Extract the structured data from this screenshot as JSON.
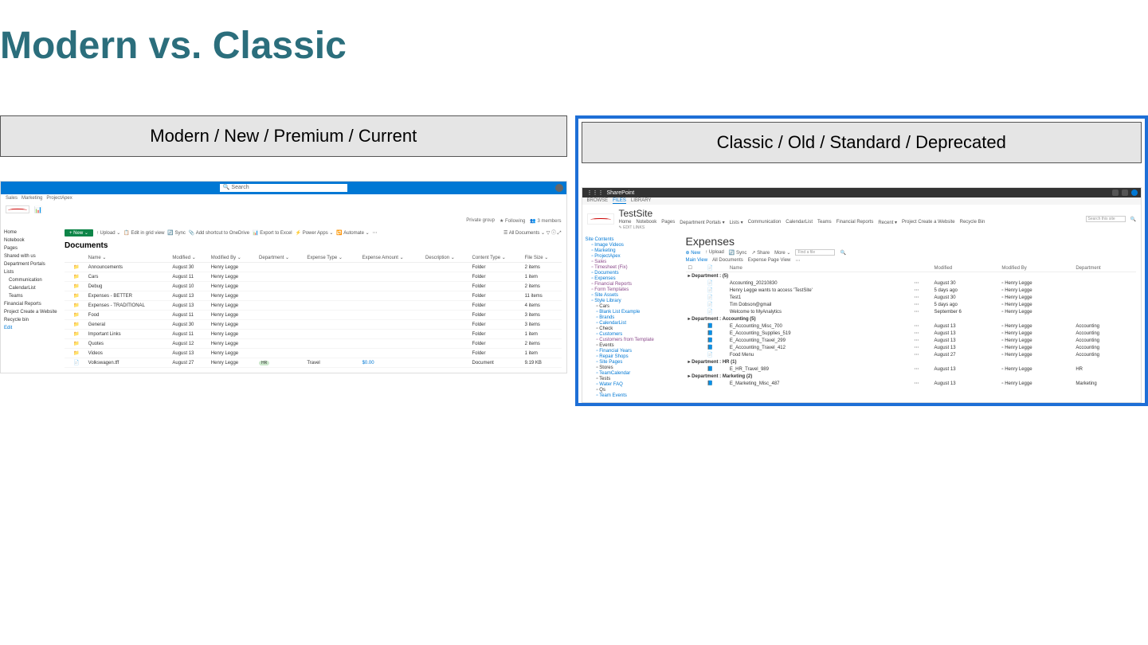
{
  "slide": {
    "title": "Modern vs. Classic"
  },
  "panels": {
    "left_label": "Modern / New / Premium / Current",
    "right_label": "Classic / Old / Standard / Deprecated"
  },
  "modern": {
    "search_placeholder": "🔍 Search",
    "nav_links": [
      "Sales",
      "Marketing",
      "ProjectApex"
    ],
    "status": {
      "group": "Private group",
      "following": "★ Following",
      "members": "👥 3 members"
    },
    "sidebar": {
      "items": [
        "Home",
        "Notebook",
        "Pages",
        "Shared with us",
        "Department Portals",
        "Lists",
        "Communication",
        "CalendarList",
        "Teams",
        "Financial Reports",
        "Project Create a Website",
        "Recycle bin",
        "Edit"
      ]
    },
    "toolbar": {
      "new": "+ New ⌄",
      "items": [
        "↑ Upload ⌄",
        "📋 Edit in grid view",
        "🔄 Sync",
        "📎 Add shortcut to OneDrive",
        "📊 Export to Excel",
        "⚡ Power Apps ⌄",
        "🔁 Automate ⌄",
        "⋯"
      ],
      "right": "☰ All Documents ⌄  ▽  ⓘ  ⤢"
    },
    "library_title": "Documents",
    "columns": [
      "",
      "",
      "Name ⌄",
      "Modified ⌄",
      "Modified By ⌄",
      "Department ⌄",
      "Expense Type ⌄",
      "Expense Amount ⌄",
      "Description ⌄",
      "Content Type ⌄",
      "File Size ⌄"
    ],
    "rows": [
      {
        "icon": "folder",
        "name": "Announcements",
        "mod": "August 30",
        "by": "Henry Legge",
        "ct": "Folder",
        "size": "2 items"
      },
      {
        "icon": "folder",
        "name": "Cars",
        "mod": "August 11",
        "by": "Henry Legge",
        "ct": "Folder",
        "size": "1 item"
      },
      {
        "icon": "folder",
        "name": "Debug",
        "mod": "August 10",
        "by": "Henry Legge",
        "ct": "Folder",
        "size": "2 items"
      },
      {
        "icon": "folder",
        "name": "Expenses - BETTER",
        "mod": "August 13",
        "by": "Henry Legge",
        "ct": "Folder",
        "size": "11 items"
      },
      {
        "icon": "folder",
        "name": "Expenses - TRADITIONAL",
        "mod": "August 13",
        "by": "Henry Legge",
        "ct": "Folder",
        "size": "4 items"
      },
      {
        "icon": "folder",
        "name": "Food",
        "mod": "August 11",
        "by": "Henry Legge",
        "ct": "Folder",
        "size": "3 items"
      },
      {
        "icon": "folder",
        "name": "General",
        "mod": "August 30",
        "by": "Henry Legge",
        "ct": "Folder",
        "size": "3 items"
      },
      {
        "icon": "folder",
        "name": "Important Links",
        "mod": "August 11",
        "by": "Henry Legge",
        "ct": "Folder",
        "size": "1 item"
      },
      {
        "icon": "folder",
        "name": "Quotes",
        "mod": "August 12",
        "by": "Henry Legge",
        "ct": "Folder",
        "size": "2 items"
      },
      {
        "icon": "folder",
        "name": "Videos",
        "mod": "August 13",
        "by": "Henry Legge",
        "ct": "Folder",
        "size": "1 item"
      },
      {
        "icon": "file",
        "name": "Volkswagen.tff",
        "mod": "August 27",
        "by": "Henry Legge",
        "dept": "HR",
        "etype": "Travel",
        "amt": "$0.00",
        "ct": "Document",
        "size": "9.19 KB"
      }
    ]
  },
  "classic": {
    "brand": "SharePoint",
    "ribbon": [
      "BROWSE",
      "FILES",
      "LIBRARY"
    ],
    "site_title": "TestSite",
    "nav_row": [
      "Home",
      "Notebook",
      "Pages",
      "Department Portals ▾",
      "Lists ▾",
      "Communication",
      "CalendarList",
      "Teams",
      "Financial Reports",
      "Recent ▾",
      "Project Create a Website",
      "Recycle Bin"
    ],
    "edit_links": "✎ EDIT LINKS",
    "search_placeholder": "Search this site",
    "tree": {
      "title": "Site Contents",
      "items": [
        {
          "label": "Image Videos",
          "cls": "tree-blue tree-sub"
        },
        {
          "label": "Marketing",
          "cls": "tree-blue tree-sub"
        },
        {
          "label": "ProjectApex",
          "cls": "tree-blue tree-sub"
        },
        {
          "label": "Sales",
          "cls": "tree-purple tree-sub"
        },
        {
          "label": "Timesheet (Fix)",
          "cls": "tree-purple tree-sub"
        },
        {
          "label": "Documents",
          "cls": "tree-blue tree-sub"
        },
        {
          "label": "Expenses",
          "cls": "tree-blue tree-sub"
        },
        {
          "label": "Financial Reports",
          "cls": "tree-purple tree-sub"
        },
        {
          "label": "Form Templates",
          "cls": "tree-purple tree-sub"
        },
        {
          "label": "Site Assets",
          "cls": "tree-blue tree-sub"
        },
        {
          "label": "Style Library",
          "cls": "tree-blue tree-sub"
        },
        {
          "label": "Cars",
          "cls": "tree-sub2"
        },
        {
          "label": "Blank List Example",
          "cls": "tree-blue tree-sub2"
        },
        {
          "label": "Brands",
          "cls": "tree-blue tree-sub2"
        },
        {
          "label": "CalendarList",
          "cls": "tree-blue tree-sub2"
        },
        {
          "label": "Check",
          "cls": "tree-sub2"
        },
        {
          "label": "Customers",
          "cls": "tree-blue tree-sub2"
        },
        {
          "label": "Customers from Template",
          "cls": "tree-purple tree-sub2"
        },
        {
          "label": "Events",
          "cls": "tree-sub2"
        },
        {
          "label": "Financial Years",
          "cls": "tree-blue tree-sub2"
        },
        {
          "label": "Repair Shops",
          "cls": "tree-blue tree-sub2"
        },
        {
          "label": "Site Pages",
          "cls": "tree-blue tree-sub2"
        },
        {
          "label": "Stores",
          "cls": "tree-sub2"
        },
        {
          "label": "TeamCalendar",
          "cls": "tree-blue tree-sub2"
        },
        {
          "label": "Tests",
          "cls": "tree-sub2"
        },
        {
          "label": "Water FAQ",
          "cls": "tree-blue tree-sub2"
        },
        {
          "label": "Qs",
          "cls": "tree-sub2"
        },
        {
          "label": "Team Events",
          "cls": "tree-blue tree-sub2"
        }
      ]
    },
    "library_title": "Expenses",
    "toolbar": {
      "new": "⊕ New",
      "upload": "↑ Upload",
      "sync": "🔄 Sync",
      "share": "↗ Share",
      "more": "More ⌄",
      "find": "Find a file"
    },
    "views": [
      "Main View",
      "All Documents",
      "Expense Page View",
      "⋯"
    ],
    "columns": [
      "☐",
      "📄",
      "Name",
      "",
      "Modified",
      "Modified By",
      "Department"
    ],
    "groups": [
      {
        "label": "▸ Department : (5)",
        "rows": [
          {
            "icon": "📄",
            "name": "Accounting_20210830",
            "mod": "August 30",
            "by": "Henry Legge"
          },
          {
            "icon": "📄",
            "name": "Henry Legge wants to access 'TestSite'",
            "mod": "5 days ago",
            "by": "Henry Legge"
          },
          {
            "icon": "📄",
            "name": "Test1",
            "mod": "August 30",
            "by": "Henry Legge"
          },
          {
            "icon": "📄",
            "name": "Tim Dobson@gmail",
            "mod": "5 days ago",
            "by": "Henry Legge"
          },
          {
            "icon": "📄",
            "name": "Welcome to MyAnalytics",
            "mod": "September 6",
            "by": "Henry Legge"
          }
        ]
      },
      {
        "label": "▸ Department : Accounting (5)",
        "rows": [
          {
            "icon": "📘",
            "name": "E_Accounting_Misc_700",
            "mod": "August 13",
            "by": "Henry Legge",
            "dept": "Accounting"
          },
          {
            "icon": "📘",
            "name": "E_Accounting_Supplies_519",
            "mod": "August 13",
            "by": "Henry Legge",
            "dept": "Accounting"
          },
          {
            "icon": "📘",
            "name": "E_Accounting_Travel_299",
            "mod": "August 13",
            "by": "Henry Legge",
            "dept": "Accounting"
          },
          {
            "icon": "📘",
            "name": "E_Accounting_Travel_412",
            "mod": "August 13",
            "by": "Henry Legge",
            "dept": "Accounting"
          },
          {
            "icon": "📄",
            "name": "Food Menu",
            "mod": "August 27",
            "by": "Henry Legge",
            "dept": "Accounting"
          }
        ]
      },
      {
        "label": "▸ Department : HR (1)",
        "rows": [
          {
            "icon": "📘",
            "name": "E_HR_Travel_989",
            "mod": "August 13",
            "by": "Henry Legge",
            "dept": "HR"
          }
        ]
      },
      {
        "label": "▸ Department : Marketing (2)",
        "rows": [
          {
            "icon": "📘",
            "name": "E_Marketing_Misc_487",
            "mod": "August 13",
            "by": "Henry Legge",
            "dept": "Marketing"
          }
        ]
      }
    ]
  }
}
